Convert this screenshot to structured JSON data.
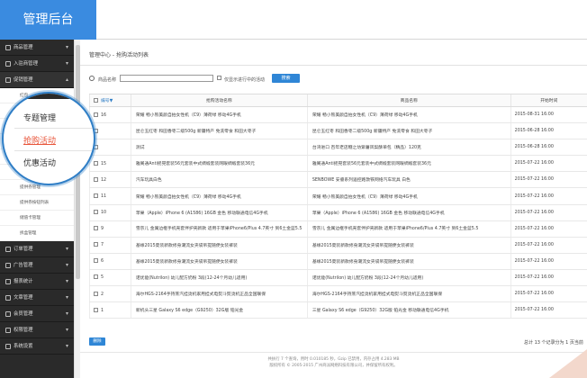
{
  "header": {
    "logo": "管理后台"
  },
  "sidebar": {
    "items_top": [
      {
        "label": "商品管理",
        "icon": "box-icon"
      },
      {
        "label": "入驻商管理",
        "icon": "store-icon"
      },
      {
        "label": "促销管理",
        "icon": "promo-icon"
      }
    ],
    "submenu": [
      "红包",
      "专题管理",
      "抢购活动",
      "优惠活动",
      "积分",
      "积分兑换商品",
      "提供券管理",
      "提供券按钮列表",
      "储值卡管理",
      "拆盒管理"
    ],
    "items_bottom": [
      {
        "label": "订单管理",
        "icon": "order-icon"
      },
      {
        "label": "广告管理",
        "icon": "ad-icon"
      },
      {
        "label": "报表统计",
        "icon": "chart-icon"
      },
      {
        "label": "文章管理",
        "icon": "article-icon"
      },
      {
        "label": "会员管理",
        "icon": "member-icon"
      },
      {
        "label": "权限管理",
        "icon": "lock-icon"
      },
      {
        "label": "系统设置",
        "icon": "gear-icon"
      }
    ]
  },
  "magnifier": {
    "item1": "专题管理",
    "item2": "抢购活动",
    "item3": "优惠活动"
  },
  "breadcrumb": "管理中心 - 抢购活动列表",
  "filter": {
    "label": "商品名称",
    "value": "",
    "checkbox_label": "仅显示进行中的活动",
    "button": "搜索"
  },
  "table": {
    "headers": [
      "编号",
      "抢购活动名称",
      "商品名称",
      "开始时间"
    ],
    "sort_arrow": "▼",
    "rows": [
      {
        "id": "16",
        "activity": "荣耀 畅小熊美颜自拍女性机（C9）薄荷绿 移动4G手机",
        "product": "荣耀 畅小熊美颜自拍女性机（C9）薄荷绿 移动4G手机",
        "start": "2015-08-31 16:00"
      },
      {
        "id": "",
        "activity": "昆仑玉红枣 和田香枣二级500g 新疆特产 免洗零食 和田大枣子",
        "product": "昆仑玉红枣 和田香枣二级500g 新疆特产 免洗零食 和田大枣子",
        "start": "2015-06-28 16:00"
      },
      {
        "id": "",
        "activity": "测试",
        "product": "台湾进口 百年老店糖之坊紫薯凤梨酥单包（精品）120克",
        "start": "2015-06-28 16:00"
      },
      {
        "id": "15",
        "activity": "雅阁通Anti摇晃套装56元套装中式绸缎套装网眼绸缎套装36元",
        "product": "雅阁通Anti摇晃套装56元套装中式绸缎套装网眼绸缎套装36元",
        "start": "2015-07-22 16:00"
      },
      {
        "id": "12",
        "activity": "汽车玩具白色",
        "product": "SENBOWE 安睿系列遥控路敦铁网络汽车玩具 白色",
        "start": "2015-07-22 16:00"
      },
      {
        "id": "11",
        "activity": "荣耀 畅小熊美颜自拍女性机（C9）薄荷绿 移动4G手机",
        "product": "荣耀 畅小熊美颜自拍女性机（C9）薄荷绿 移动4G手机",
        "start": "2015-07-22 16:00"
      },
      {
        "id": "10",
        "activity": "苹果（Apple）iPhone 6 (A1586) 16GB 金色 移动联通电信4G手机",
        "product": "苹果（Apple）iPhone 6 (A1586) 16GB 金色 移动联通电信4G手机",
        "start": "2015-07-22 16:00"
      },
      {
        "id": "9",
        "activity": "雪京儿 金属边框手机壳套伴护壳新款 适用于苹果iPhone6/Plus 4.7英寸 到6土金蓝5.5",
        "product": "雪京儿 金属边框手机壳套伴护壳新款 适用于苹果iPhone6/Plus 4.7英寸 到6土金蓝5.5",
        "start": "2015-07-22 16:00",
        "twoline": true
      },
      {
        "id": "7",
        "activity": "基缘2015夏装新款修身潮流女夹袋吊提随便女装裤装",
        "product": "基缘2015夏装新款修身潮流女夹袋吊提随便女装裤装",
        "start": "2015-07-22 16:00"
      },
      {
        "id": "6",
        "activity": "基缘2015夏装新款修身潮流女夹袋吊提随便女装裤装",
        "product": "基缘2015夏装新款修身潮流女夹袋吊提随便女装裤装",
        "start": "2015-07-22 16:00"
      },
      {
        "id": "5",
        "activity": "诺优能(Nutrilon) 幼儿配方奶粉 3段(12-24个月幼儿适用)",
        "product": "诺优能(Nutrilon) 幼儿配方奶粉 3段(12-24个月幼儿适用)",
        "start": "2015-07-22 16:00"
      },
      {
        "id": "2",
        "activity": "海尔HGS-2164手持蒸汽挂烫机家用挂式电熨斗熨烫机正品全国联保",
        "product": "海尔HGS-2164手持蒸汽挂烫机家用挂式电熨斗熨烫机正品全国联保",
        "start": "2015-07-22 16:00"
      },
      {
        "id": "1",
        "activity": "新机头三星 Galaxy S6 edge（G9250）32G版 铂光金",
        "product": "三星 Galaxy S6 edge（G9250）32G版 铂光金 移动联通电信4G手机",
        "start": "2015-07-22 16:00"
      }
    ]
  },
  "actions": {
    "delete": "删除"
  },
  "pager": {
    "text": "总计 13 个记录分为 1 页当前"
  },
  "footer": {
    "line1": "共执行 7 个查询，用时 0.010185 秒，Gzip 已禁用，内存占用 4.283 MB",
    "line2": "版权所有 © 2005-2015 广州商派网络科技有限公司，并保留所有权利。"
  }
}
